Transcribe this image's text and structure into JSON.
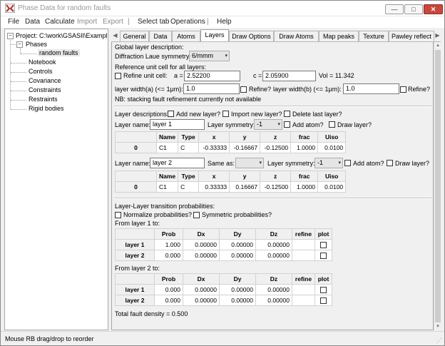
{
  "window": {
    "title": "Phase Data for random faults",
    "buttons": {
      "minimize": "—",
      "maximize": "□",
      "close": "✕"
    },
    "colors": {
      "close": "#c9473b",
      "selected": "#e8e8e8"
    }
  },
  "menu": [
    {
      "label": "File",
      "dim": false
    },
    {
      "label": "Data",
      "dim": false
    },
    {
      "label": "Calculate",
      "dim": false
    },
    {
      "label": "Import",
      "dim": true
    },
    {
      "label": "Export",
      "dim": true
    },
    {
      "label": "|",
      "dim": true
    },
    {
      "label": "Select tab",
      "dim": false
    },
    {
      "label": "Operations",
      "dim": false
    },
    {
      "label": "|",
      "dim": true
    },
    {
      "label": "Help",
      "dim": false
    }
  ],
  "tree": {
    "project": "Project: C:\\work\\GSASII\\Exampl",
    "phases": "Phases",
    "phase_item": "random faults",
    "items": [
      "Notebook",
      "Controls",
      "Covariance",
      "Constraints",
      "Restraints",
      "Rigid bodies"
    ],
    "expander_collapse": "−"
  },
  "tabs": {
    "left_arrow": "◀",
    "right_arrow": "▶",
    "items": [
      "General",
      "Data",
      "Atoms",
      "Layers",
      "Draw Options",
      "Draw Atoms",
      "Map peaks",
      "Texture",
      "Pawley reflect"
    ],
    "active": "Layers"
  },
  "layers": {
    "global_title": "Global layer description:",
    "laue_label": "Diffraction Laue symmetry:",
    "laue_value": "6/mmm",
    "ref_cell_title": "Reference unit cell for all layers:",
    "refine_cell_label": "Refine unit cell:",
    "a_label": "a =",
    "a_value": "2.52200",
    "c_label": "c =",
    "c_value": "2.05900",
    "vol_text": "Vol = 11.342",
    "width_a_label": "layer width(a) (<= 1μm):",
    "width_a_value": "1.0",
    "refine_label": "Refine?",
    "width_b_label": "layer width(b) (<= 1μm):",
    "width_b_value": "1.0",
    "refine_b_label": "Refine?",
    "nb_text": "NB: stacking fault refinement currently not available",
    "layer_desc_label": "Layer descriptions:",
    "add_layer": "Add new layer?",
    "import_layer": "Import new layer?",
    "delete_layer": "Delete last layer?",
    "layer_name_label": "Layer name:",
    "layer_symmetry_label": "Layer symmetry:",
    "add_atom": "Add atom?",
    "draw_layer": "Draw layer?",
    "same_as_label": "Same as:",
    "layer1": {
      "name": "layer 1",
      "symmetry": "-1",
      "headers": [
        "",
        "Name",
        "Type",
        "x",
        "y",
        "z",
        "frac",
        "Uiso"
      ],
      "rows": [
        [
          "0",
          "C1",
          "C",
          "-0.33333",
          "-0.16667",
          "-0.12500",
          "1.0000",
          "0.0100"
        ]
      ]
    },
    "layer2": {
      "name": "layer 2",
      "same_as": "",
      "symmetry": "-1",
      "headers": [
        "",
        "Name",
        "Type",
        "x",
        "y",
        "z",
        "frac",
        "Uiso"
      ],
      "rows": [
        [
          "0",
          "C1",
          "C",
          "0.33333",
          "0.16667",
          "-0.12500",
          "1.0000",
          "0.0100"
        ]
      ]
    },
    "transition_title": "Layer-Layer transition probabilities:",
    "normalize_label": "Normalize probabilities?",
    "symmetric_label": "Symmetric probabilities?",
    "from_layer1": "From layer 1 to:",
    "from_layer2": "From layer 2 to:",
    "trans_headers": [
      "",
      "Prob",
      "Dx",
      "Dy",
      "Dz",
      "refine",
      "plot"
    ],
    "trans1": [
      [
        "layer 1",
        "1.000",
        "0.00000",
        "0.00000",
        "0.00000"
      ],
      [
        "layer 2",
        "0.000",
        "0.00000",
        "0.00000",
        "0.00000"
      ]
    ],
    "trans2": [
      [
        "layer 1",
        "0.000",
        "0.00000",
        "0.00000",
        "0.00000"
      ],
      [
        "layer 2",
        "0.000",
        "0.00000",
        "0.00000",
        "0.00000"
      ]
    ],
    "fault_density": "Total fault density = 0.500"
  },
  "status": {
    "text": "Mouse RB drag/drop to reorder",
    "grip": "⋰"
  },
  "icons": {
    "combo_arrow": "▾",
    "scroll_up": "▴",
    "scroll_down": "▾"
  }
}
